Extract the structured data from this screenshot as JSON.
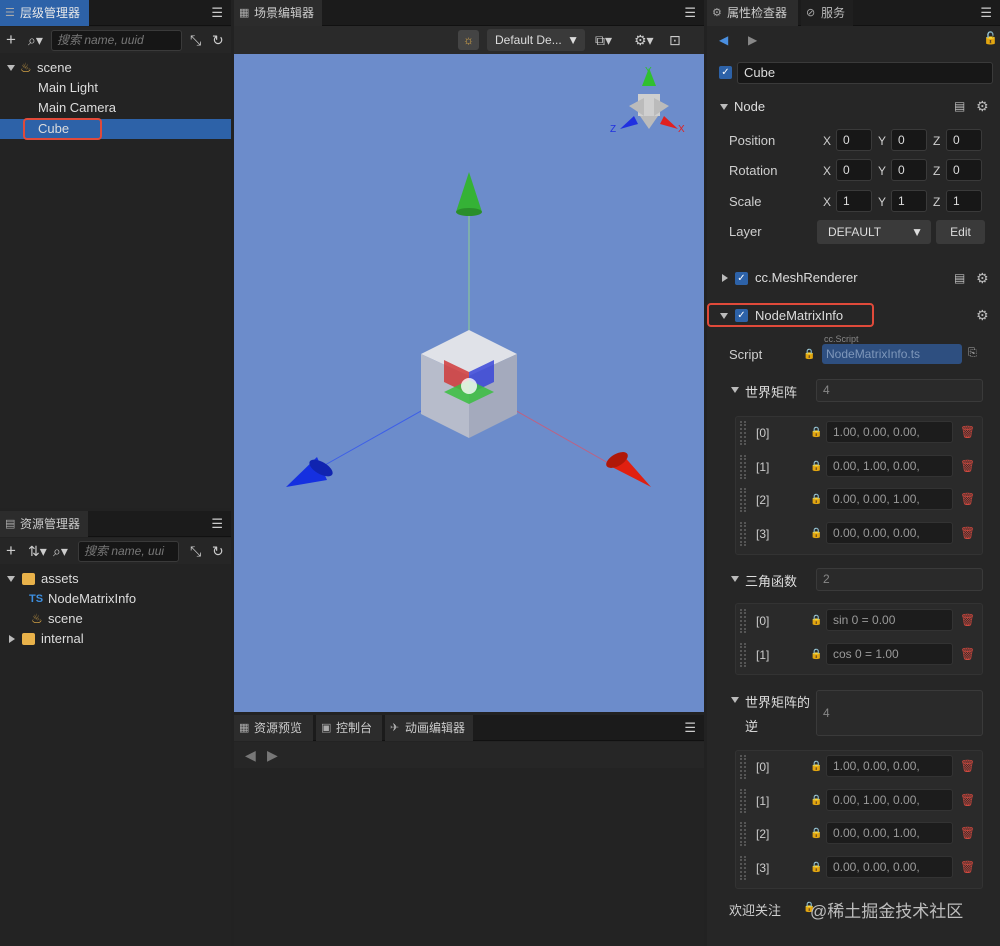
{
  "hierarchy": {
    "title": "层级管理器",
    "search_placeholder": "搜索 name, uuid",
    "items": [
      "scene",
      "Main Light",
      "Main Camera",
      "Cube"
    ]
  },
  "assets": {
    "title": "资源管理器",
    "search_placeholder": "搜索 name, uui",
    "items": [
      "assets",
      "NodeMatrixInfo",
      "scene",
      "internal"
    ],
    "ts_badge": "TS"
  },
  "scene_editor": {
    "title": "场景编辑器",
    "camera_dropdown": "Default De...",
    "gizmo_labels": {
      "y": "Y",
      "z": "Z",
      "x": "X"
    }
  },
  "bottom_tabs": [
    "资源预览",
    "控制台",
    "动画编辑器"
  ],
  "inspector": {
    "tabs": [
      "属性检查器",
      "服务"
    ],
    "node_name": "Cube",
    "node_section": "Node",
    "position_label": "Position",
    "rotation_label": "Rotation",
    "scale_label": "Scale",
    "layer_label": "Layer",
    "axis": {
      "x": "X",
      "y": "Y",
      "z": "Z"
    },
    "position": [
      "0",
      "0",
      "0"
    ],
    "rotation": [
      "0",
      "0",
      "0"
    ],
    "scale": [
      "1",
      "1",
      "1"
    ],
    "layer_value": "DEFAULT",
    "edit_button": "Edit",
    "mesh_renderer": "cc.MeshRenderer",
    "component": "NodeMatrixInfo",
    "script_label": "Script",
    "script_type": "cc.Script",
    "script_value": "NodeMatrixInfo.ts",
    "world_matrix": {
      "label": "世界矩阵",
      "count": "4",
      "rows": [
        {
          "index": "[0]",
          "value": "1.00,  0.00,    0.00,"
        },
        {
          "index": "[1]",
          "value": "0.00,  1.00,    0.00,"
        },
        {
          "index": "[2]",
          "value": "0.00,  0.00,    1.00,"
        },
        {
          "index": "[3]",
          "value": "0.00,  0.00,    0.00,"
        }
      ]
    },
    "trig": {
      "label": "三角函数",
      "count": "2",
      "rows": [
        {
          "index": "[0]",
          "value": "sin 0 = 0.00"
        },
        {
          "index": "[1]",
          "value": "cos 0 = 1.00"
        }
      ]
    },
    "world_matrix_inv": {
      "label_line1": "世界矩阵的",
      "label_line2": "逆",
      "count": "4",
      "rows": [
        {
          "index": "[0]",
          "value": "1.00,  0.00,    0.00,"
        },
        {
          "index": "[1]",
          "value": "0.00,  1.00,    0.00,"
        },
        {
          "index": "[2]",
          "value": "0.00,  0.00,    1.00,"
        },
        {
          "index": "[3]",
          "value": "0.00,  0.00,    0.00,"
        }
      ]
    },
    "welcome_label": "欢迎关注",
    "watermark": "@稀土掘金技术社区"
  }
}
